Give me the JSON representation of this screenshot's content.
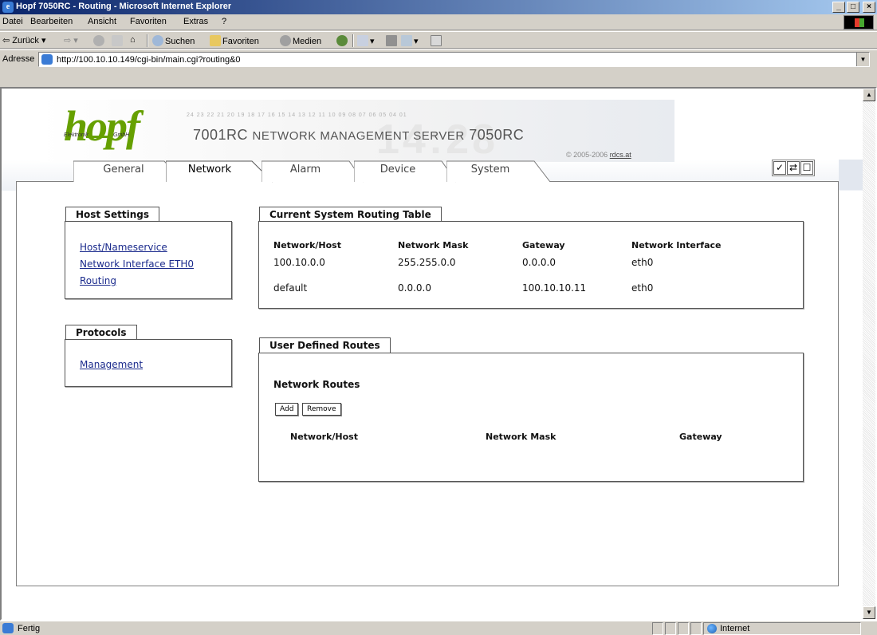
{
  "window": {
    "title": "Hopf 7050RC - Routing - Microsoft Internet Explorer"
  },
  "menubar": {
    "items": [
      "Datei",
      "Bearbeiten",
      "Ansicht",
      "Favoriten",
      "Extras",
      "?"
    ]
  },
  "toolbar": {
    "back": "Zurück",
    "search": "Suchen",
    "favorites": "Favoriten",
    "media": "Medien"
  },
  "addressbar": {
    "label": "Adresse",
    "url": "http://100.10.10.149/cgi-bin/main.cgi?routing&0"
  },
  "header": {
    "logo": "hopf",
    "logo_sub1": "Elektronik",
    "logo_sub2": "GmbH",
    "digits": "24 23 22 21 20 19 18 17 16 15 14 13 12 11 10 09 08 07 06 05 04 01",
    "title_prefix": "7001RC ",
    "title_middle": "NETWORK MANAGEMENT SERVER",
    "title_suffix": " 7050RC",
    "bg_clock": "14:28",
    "copyright_prefix": "© 2005-2006 ",
    "copyright_link": "rdcs.at"
  },
  "tabs": [
    {
      "label": "General",
      "active": false
    },
    {
      "label": "Network",
      "active": true
    },
    {
      "label": "Alarm",
      "active": false
    },
    {
      "label": "Device",
      "active": false
    },
    {
      "label": "System",
      "active": false
    }
  ],
  "tool_icons": [
    "check-icon",
    "refresh-icon",
    "window-icon"
  ],
  "host_settings": {
    "title": "Host Settings",
    "links": [
      "Host/Nameservice",
      "Network Interface ETH0",
      "Routing"
    ]
  },
  "protocols": {
    "title": "Protocols",
    "links": [
      "Management"
    ]
  },
  "routing_table": {
    "title": "Current System Routing Table",
    "columns": [
      "Network/Host",
      "Network Mask",
      "Gateway",
      "Network Interface"
    ],
    "rows": [
      [
        "100.10.0.0",
        "255.255.0.0",
        "0.0.0.0",
        "eth0"
      ],
      [
        "default",
        "0.0.0.0",
        "100.10.10.11",
        "eth0"
      ]
    ]
  },
  "user_routes": {
    "title": "User Defined Routes",
    "subtitle": "Network Routes",
    "add_label": "Add",
    "remove_label": "Remove",
    "columns": [
      "Network/Host",
      "Network Mask",
      "Gateway"
    ]
  },
  "statusbar": {
    "status": "Fertig",
    "zone": "Internet"
  }
}
